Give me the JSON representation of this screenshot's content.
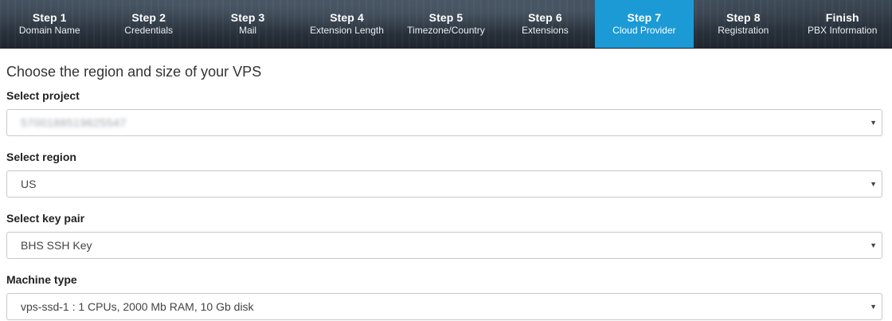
{
  "wizard": {
    "steps": [
      {
        "title": "Step 1",
        "subtitle": "Domain Name"
      },
      {
        "title": "Step 2",
        "subtitle": "Credentials"
      },
      {
        "title": "Step 3",
        "subtitle": "Mail"
      },
      {
        "title": "Step 4",
        "subtitle": "Extension Length"
      },
      {
        "title": "Step 5",
        "subtitle": "Timezone/Country"
      },
      {
        "title": "Step 6",
        "subtitle": "Extensions"
      },
      {
        "title": "Step 7",
        "subtitle": "Cloud Provider"
      },
      {
        "title": "Step 8",
        "subtitle": "Registration"
      },
      {
        "title": "Finish",
        "subtitle": "PBX Information"
      }
    ],
    "active_index": 6,
    "active_color": "#1b9ad6"
  },
  "form": {
    "heading": "Choose the region and size of your VPS",
    "project": {
      "label": "Select project",
      "value": "5700188519625547"
    },
    "region": {
      "label": "Select region",
      "value": "US"
    },
    "key_pair": {
      "label": "Select key pair",
      "value": "BHS SSH Key"
    },
    "machine_type": {
      "label": "Machine type",
      "value": "vps-ssd-1 : 1 CPUs, 2000 Mb RAM, 10 Gb disk"
    }
  },
  "icons": {
    "dropdown": "caret-down-icon"
  }
}
